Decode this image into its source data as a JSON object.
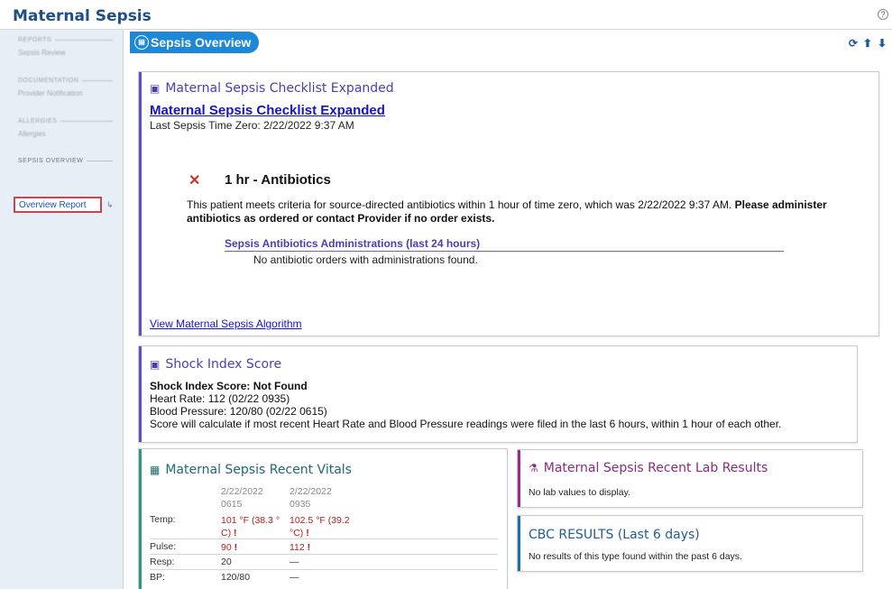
{
  "app": {
    "title": "Maternal Sepsis",
    "help_glyph": "?"
  },
  "sidebar": {
    "section_1": {
      "header": "REPORTS",
      "link": "Sepsis Review"
    },
    "section_2": {
      "header": "DOCUMENTATION",
      "link": "Provider Notification"
    },
    "section_3": {
      "header": "ALLERGIES",
      "link": "Allergies"
    },
    "section_4": {
      "header": "SEPSIS OVERVIEW",
      "link": "Overview Report"
    }
  },
  "tab": {
    "label": "Sepsis Overview"
  },
  "toolbar": {
    "refresh_glyph": "⟳",
    "up_glyph": "⬆",
    "down_glyph": "⬇"
  },
  "checklist": {
    "card_title": "Maternal Sepsis Checklist Expanded",
    "link_title": "Maternal Sepsis Checklist Expanded",
    "last_time_zero": "Last Sepsis Time Zero: 2/22/2022  9:37 AM",
    "status_glyph": "✕",
    "item_title": "1 hr - Antibiotics",
    "item_text": "This patient meets criteria for source-directed antibiotics within 1 hour of time zero, which was 2/22/2022  9:37 AM.",
    "item_text_bold": "Please administer antibiotics as ordered or contact Provider if no order exists.",
    "admin_header": "Sepsis Antibiotics Administrations (last 24 hours)",
    "admin_none": "No antibiotic orders with administrations found.",
    "algorithm_link": "View Maternal Sepsis Algorithm"
  },
  "shock_index": {
    "card_title": "Shock Index Score",
    "score_line": "Shock Index Score: Not Found",
    "heart_rate": "Heart Rate: 112 (02/22 0935)",
    "blood_pressure": "Blood Pressure: 120/80 (02/22 0615)",
    "note": "Score will calculate if most recent Heart Rate and Blood Pressure readings were filed in the last 6 hours, within 1 hour of each other."
  },
  "vitals": {
    "card_title": "Maternal Sepsis Recent Vitals",
    "col1_date": "2/22/2022",
    "col1_time": "0615",
    "col2_date": "2/22/2022",
    "col2_time": "0935",
    "temp_label": "Temp:",
    "temp_v1_a": "101 °F (38.3 °",
    "temp_v1_b": "C)",
    "temp_v2_a": "102.5 °F (39.2",
    "temp_v2_b": "°C)",
    "pulse_label": "Pulse:",
    "pulse_v1": "90",
    "pulse_v2": "112",
    "resp_label": "Resp:",
    "resp_v1": "20",
    "resp_v2": "—",
    "bp_label": "BP:",
    "bp_v1": "120/80",
    "bp_v2": "—",
    "flag_glyph": "!"
  },
  "labs": {
    "card_title": "Maternal Sepsis Recent Lab Results",
    "message": "No lab values to display."
  },
  "cbc": {
    "card_title": "CBC RESULTS (Last 6 days)",
    "message": "No results of this type found within the past 6 days."
  },
  "colors": {
    "header_blue": "#1f4f86",
    "tab_blue": "#1e88d8",
    "purple": "#4b3fb0",
    "teal": "#2a9a86",
    "magenta": "#9b2a8e",
    "alert_red": "#d01010"
  }
}
